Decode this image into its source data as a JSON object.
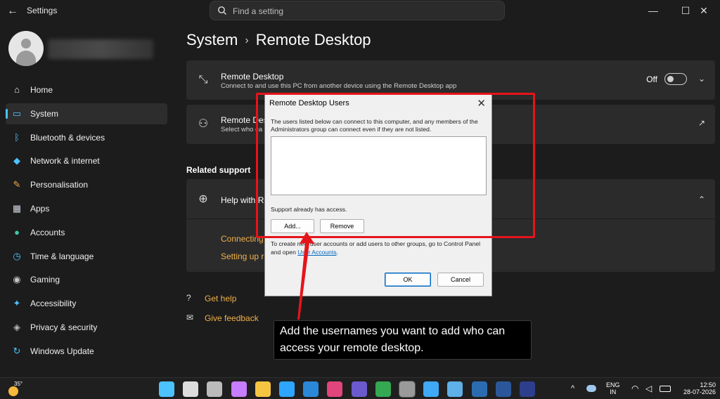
{
  "titlebar": {
    "back_glyph": "←",
    "app_title": "Settings",
    "search_placeholder": "Find a setting",
    "minimize": "—",
    "maximize": "☐",
    "close": "✕"
  },
  "sidebar": {
    "items": [
      {
        "label": "Home",
        "icon": "home-icon",
        "glyph": "⌂",
        "color": "#e8e8e8"
      },
      {
        "label": "System",
        "icon": "system-icon",
        "glyph": "▭",
        "color": "#4cc2ff"
      },
      {
        "label": "Bluetooth & devices",
        "icon": "bluetooth-icon",
        "glyph": "ᛒ",
        "color": "#4cc2ff"
      },
      {
        "label": "Network & internet",
        "icon": "wifi-icon",
        "glyph": "◆",
        "color": "#4cc2ff"
      },
      {
        "label": "Personalisation",
        "icon": "brush-icon",
        "glyph": "✎",
        "color": "#f0a54b"
      },
      {
        "label": "Apps",
        "icon": "apps-icon",
        "glyph": "▦",
        "color": "#cfd6e0"
      },
      {
        "label": "Accounts",
        "icon": "accounts-icon",
        "glyph": "●",
        "color": "#3ec9a7"
      },
      {
        "label": "Time & language",
        "icon": "clock-globe-icon",
        "glyph": "◷",
        "color": "#4cc2ff"
      },
      {
        "label": "Gaming",
        "icon": "gamepad-icon",
        "glyph": "◉",
        "color": "#c8c8c8"
      },
      {
        "label": "Accessibility",
        "icon": "accessibility-icon",
        "glyph": "✦",
        "color": "#4cc2ff"
      },
      {
        "label": "Privacy & security",
        "icon": "shield-icon",
        "glyph": "◈",
        "color": "#b8b8b8"
      },
      {
        "label": "Windows Update",
        "icon": "update-icon",
        "glyph": "↻",
        "color": "#4cc2ff"
      }
    ],
    "active_index": 1
  },
  "main": {
    "breadcrumb_parent": "System",
    "breadcrumb_sep": "›",
    "breadcrumb_current": "Remote Desktop",
    "rd_card": {
      "title": "Remote Desktop",
      "subtitle": "Connect to and use this PC from another device using the Remote Desktop app",
      "toggle_label": "Off",
      "chevron": "⌄"
    },
    "users_card": {
      "title": "Remote Des",
      "subtitle": "Select who ca",
      "open_glyph": "↗"
    },
    "related_support": "Related support",
    "help_card": {
      "title": "Help with Re",
      "chevron": "⌃",
      "links": [
        "Connecting",
        "Setting up r"
      ]
    },
    "get_help": "Get help",
    "give_feedback": "Give feedback"
  },
  "dialog": {
    "title": "Remote Desktop Users",
    "close": "✕",
    "description": "The users listed below can connect to this computer, and any members of the Administrators group can connect even if they are not listed.",
    "note": "Support already has access.",
    "add_button": "Add...",
    "remove_button": "Remove",
    "info_prefix": "To create new user accounts or add users to other groups, go to Control Panel and open ",
    "info_link": "User Accounts",
    "info_suffix": ".",
    "ok_button": "OK",
    "cancel_button": "Cancel"
  },
  "annotation": {
    "callout_text": "Add the usernames you want to add who can access your remote desktop.",
    "color": "#e5141a"
  },
  "taskbar": {
    "temperature": "35°",
    "language_line1": "ENG",
    "language_line2": "IN",
    "time": "12:50",
    "date": "28-07-2026",
    "tray_chevron": "^",
    "tray_icons": [
      "cloud-icon",
      "wifi-icon",
      "volume-icon",
      "battery-icon"
    ],
    "apps": [
      "start-icon",
      "search-icon",
      "task-view-icon",
      "copilot-icon",
      "file-explorer-icon",
      "edge-icon",
      "store-icon",
      "slack-icon",
      "snipping-tool-icon",
      "chrome-icon",
      "settings-icon",
      "photos-icon",
      "paint-icon",
      "remote-desktop-icon",
      "word-icon",
      "powershell-icon"
    ]
  }
}
